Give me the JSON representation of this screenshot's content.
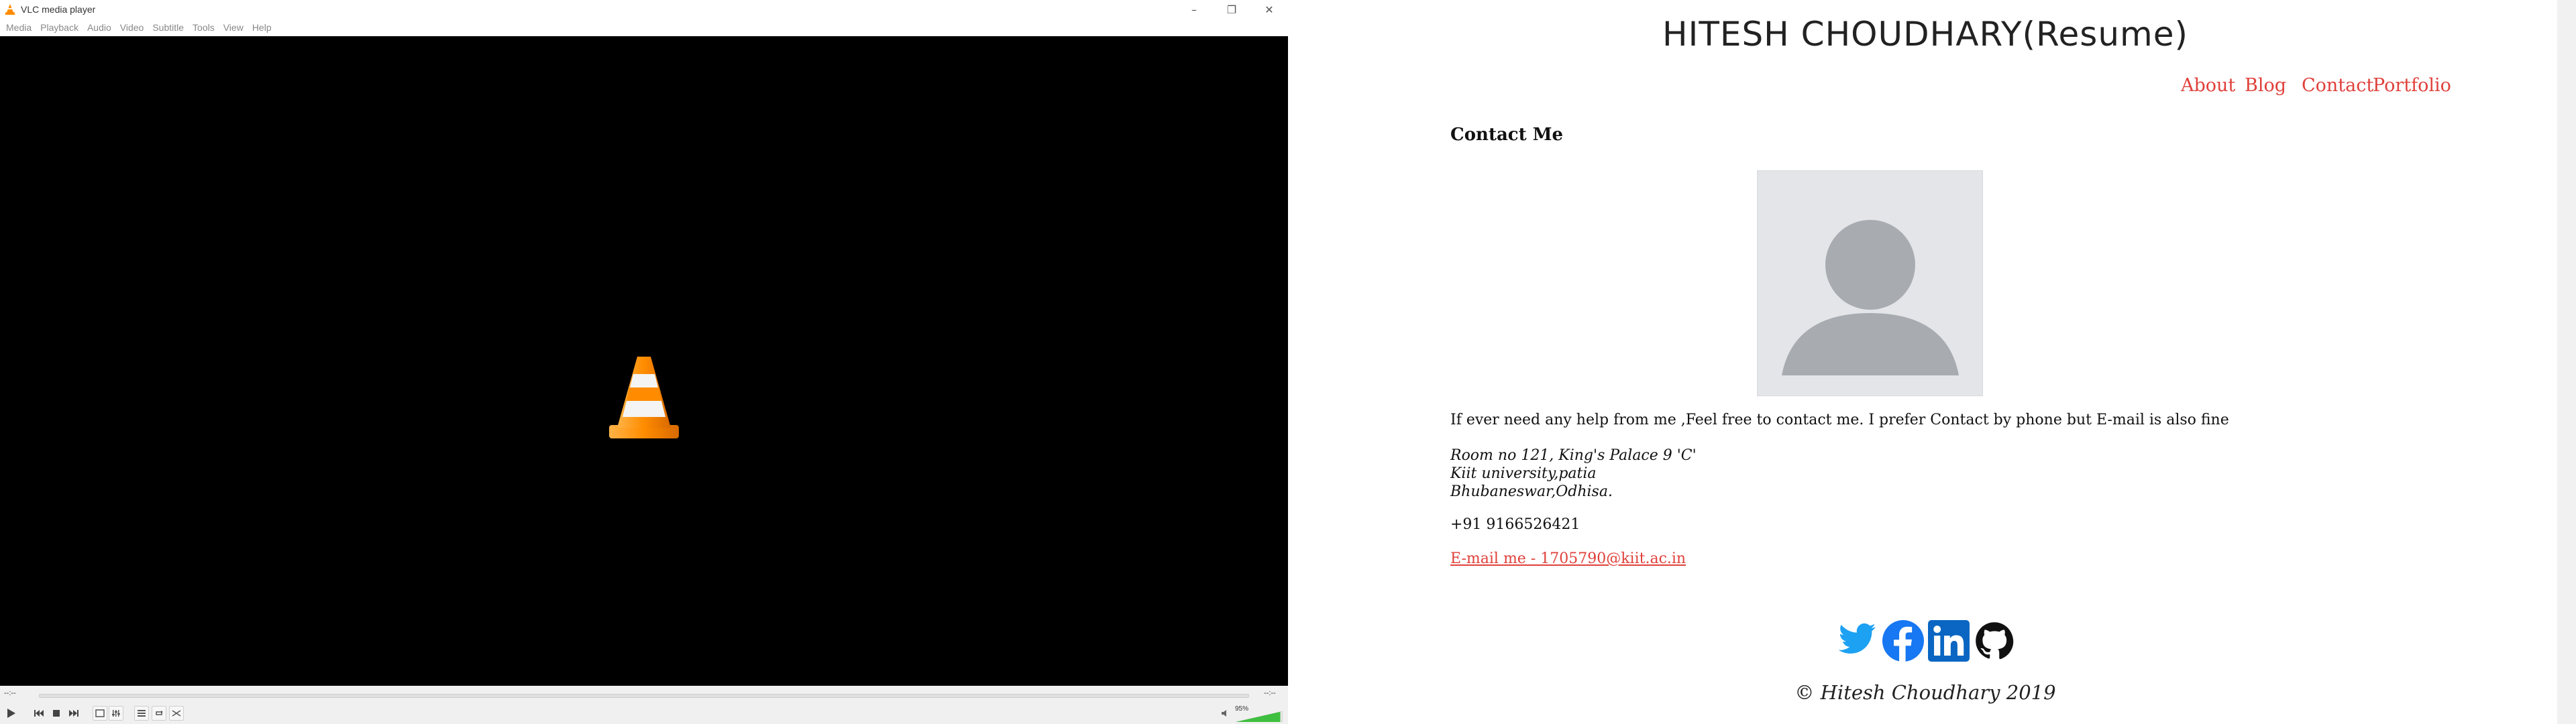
{
  "vlc": {
    "title": "VLC media player",
    "window_buttons": [
      "–",
      "❐",
      "✕"
    ],
    "menu": [
      "Media",
      "Playback",
      "Audio",
      "Video",
      "Subtitle",
      "Tools",
      "View",
      "Help"
    ],
    "time_elapsed": "--:--",
    "time_total": "--:--",
    "volume": "95%",
    "volume_level": 0.95,
    "cone_colors": {
      "orange": "#ff8c00",
      "white": "#f4f4f4"
    }
  },
  "site": {
    "title": "HITESH CHOUDHARY(Resume)",
    "nav": [
      "About",
      "Blog",
      "Contact",
      "Portfolio"
    ],
    "section_title": "Contact Me",
    "contact_text": "If ever need any help from me ,Feel free to contact me. I prefer Contact by phone but E-mail is also fine",
    "address": [
      "Room no 121, King's Palace 9 'C'",
      "Kiit university,patia",
      "Bhubaneswar,Odhisa."
    ],
    "phone": "+91 9166526421",
    "email": "E-mail me - 1705790@kiit.ac.in",
    "socials": [
      "twitter-icon",
      "facebook-icon",
      "linkedin-icon",
      "github-icon"
    ],
    "footer": "© Hitesh Choudhary 2019",
    "accent_color": "#e0403a"
  }
}
